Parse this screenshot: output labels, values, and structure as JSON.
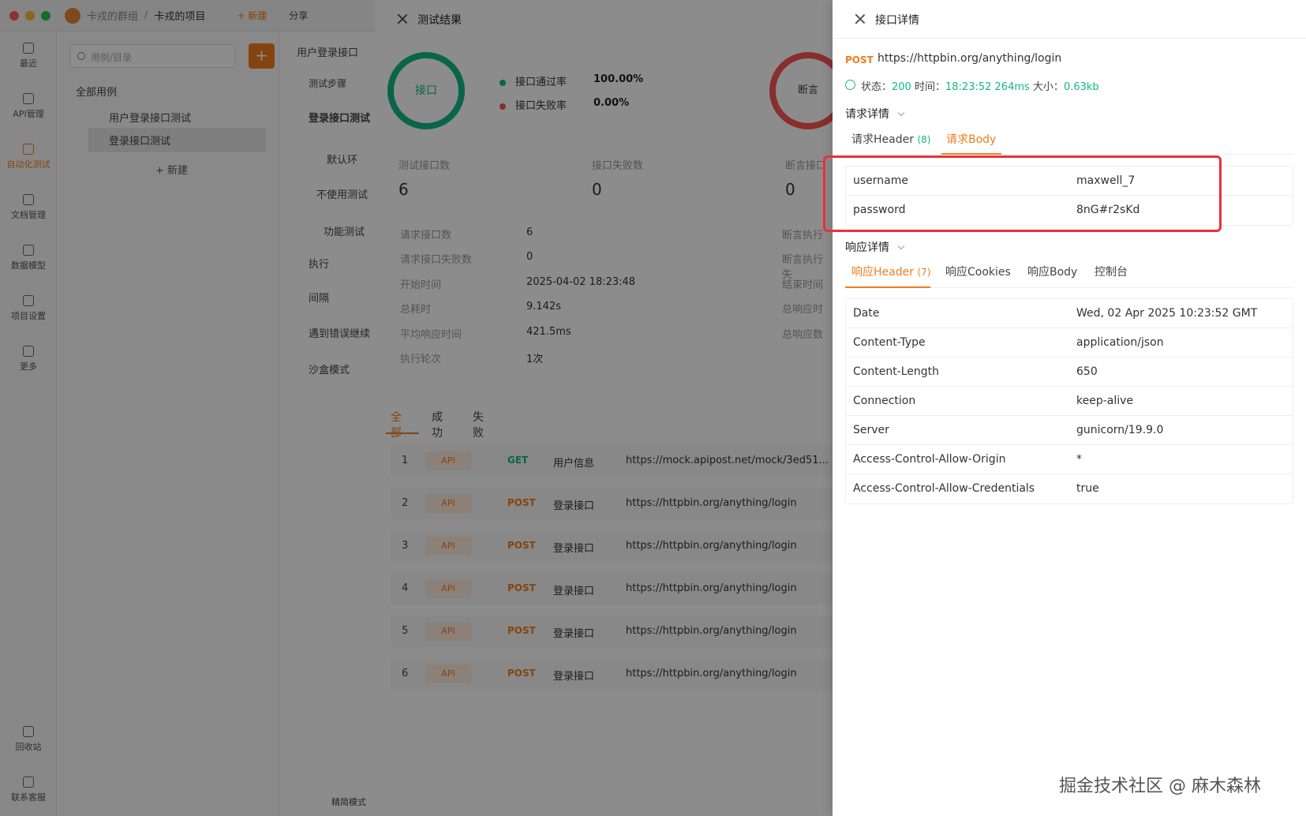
{
  "titlebar": {
    "team": "卡戎的群组",
    "project": "卡戎的项目",
    "new_label": "+ 新建",
    "share_label": "分享"
  },
  "leftnav": [
    {
      "label": "最近",
      "icon": "clock-icon"
    },
    {
      "label": "API管理",
      "icon": "api-icon"
    },
    {
      "label": "自动化测试",
      "icon": "automation-icon",
      "active": true
    },
    {
      "label": "文档管理",
      "icon": "document-icon"
    },
    {
      "label": "数据模型",
      "icon": "model-icon"
    },
    {
      "label": "项目设置",
      "icon": "settings-icon"
    },
    {
      "label": "更多",
      "icon": "more-icon"
    },
    {
      "label": "回收站",
      "icon": "trash-icon"
    },
    {
      "label": "联系客服",
      "icon": "headset-icon"
    }
  ],
  "tree": {
    "search_placeholder": "用例/目录",
    "root": "全部用例",
    "items": [
      "用户登录接口测试",
      "登录接口测试"
    ],
    "new_label": "新建"
  },
  "main": {
    "tab": "用户登录接口",
    "steps": "测试步骤",
    "heading": "登录接口测试",
    "env": "默认环",
    "no_use": "不使用测试",
    "mode": "功能测试",
    "exec": "执行",
    "interval": "间隔",
    "on_error": "遇到错误继续",
    "sandbox": "沙盒模式",
    "bottom": "精简模式"
  },
  "results": {
    "title": "测试结果",
    "ring_label": "接口",
    "ring2_label": "断言",
    "pass_label": "接口通过率",
    "pass_value": "100.00%",
    "fail_label": "接口失败率",
    "fail_value": "0.00%",
    "stats": [
      {
        "label": "测试接口数",
        "value": "6"
      },
      {
        "label": "接口失败数",
        "value": "0"
      },
      {
        "label": "断言接口",
        "value": "0"
      }
    ],
    "kv": [
      {
        "label": "请求接口数",
        "value": "6"
      },
      {
        "label": "请求接口失败数",
        "value": "0"
      },
      {
        "label": "开始时间",
        "value": "2025-04-02 18:23:48"
      },
      {
        "label": "总耗时",
        "value": "9.142s"
      },
      {
        "label": "平均响应时间",
        "value": "421.5ms"
      },
      {
        "label": "执行轮次",
        "value": "1次"
      }
    ],
    "side_labels": [
      "断言执行",
      "断言执行失",
      "结束时间",
      "总响应时",
      "总响应数"
    ],
    "tabs": [
      "全部",
      "成功",
      "失败"
    ],
    "rows": [
      {
        "idx": "1",
        "badge": "API",
        "method": "GET",
        "name": "用户信息",
        "url": "https://mock.apipost.net/mock/3ed51..."
      },
      {
        "idx": "2",
        "badge": "API",
        "method": "POST",
        "name": "登录接口",
        "url": "https://httpbin.org/anything/login"
      },
      {
        "idx": "3",
        "badge": "API",
        "method": "POST",
        "name": "登录接口",
        "url": "https://httpbin.org/anything/login"
      },
      {
        "idx": "4",
        "badge": "API",
        "method": "POST",
        "name": "登录接口",
        "url": "https://httpbin.org/anything/login"
      },
      {
        "idx": "5",
        "badge": "API",
        "method": "POST",
        "name": "登录接口",
        "url": "https://httpbin.org/anything/login"
      },
      {
        "idx": "6",
        "badge": "API",
        "method": "POST",
        "name": "登录接口",
        "url": "https://httpbin.org/anything/login"
      }
    ]
  },
  "detail": {
    "title": "接口详情",
    "method": "POST",
    "url": "https://httpbin.org/anything/login",
    "status_label": "状态：",
    "status": "200",
    "time_label": "时间：",
    "time": "18:23:52",
    "duration": "264ms",
    "size_label": "大小：",
    "size": "0.63kb",
    "request_section": "请求详情",
    "request_tabs": [
      {
        "label": "请求Header",
        "count": "(8)"
      },
      {
        "label": "请求Body",
        "count": ""
      }
    ],
    "request_body": [
      {
        "key": "username",
        "value": "maxwell_7"
      },
      {
        "key": "password",
        "value": "8nG#r2sKd"
      }
    ],
    "response_section": "响应详情",
    "response_tabs": [
      {
        "label": "响应Header",
        "count": "(7)"
      },
      {
        "label": "响应Cookies",
        "count": ""
      },
      {
        "label": "响应Body",
        "count": ""
      },
      {
        "label": "控制台",
        "count": ""
      }
    ],
    "response_headers": [
      {
        "key": "Date",
        "value": "Wed, 02 Apr 2025 10:23:52 GMT"
      },
      {
        "key": "Content-Type",
        "value": "application/json"
      },
      {
        "key": "Content-Length",
        "value": "650"
      },
      {
        "key": "Connection",
        "value": "keep-alive"
      },
      {
        "key": "Server",
        "value": "gunicorn/19.9.0"
      },
      {
        "key": "Access-Control-Allow-Origin",
        "value": "*"
      },
      {
        "key": "Access-Control-Allow-Credentials",
        "value": "true"
      }
    ]
  },
  "colors": {
    "accent": "#f07c1c",
    "success": "#12b886",
    "fail": "#fa5252",
    "highlight": "#e8313a",
    "get": "#12b886",
    "post": "#f07c1c"
  },
  "watermark": "掘金技术社区 @ 麻木森林"
}
